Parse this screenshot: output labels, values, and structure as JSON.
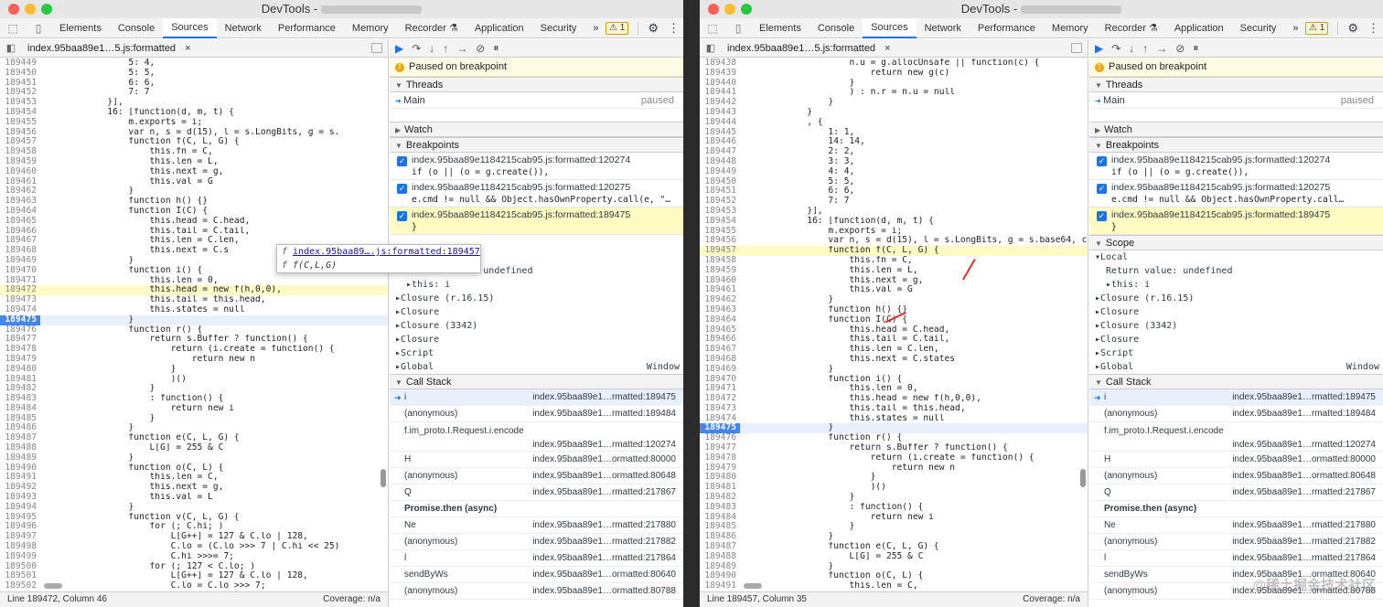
{
  "title": "DevTools -",
  "tabs": [
    "Elements",
    "Console",
    "Sources",
    "Network",
    "Performance",
    "Memory",
    "Recorder ⚗",
    "Application",
    "Security"
  ],
  "more_tabs": "»",
  "badge": "1",
  "left": {
    "file": "index.95baa89e1…5.js:formatted",
    "status_left": "Line 189472, Column 46",
    "status_right": "Coverage: n/a",
    "code": [
      [
        "189449",
        "                5: 4,",
        ""
      ],
      [
        "189450",
        "                5: 5,",
        ""
      ],
      [
        "189451",
        "                6: 6,",
        ""
      ],
      [
        "189452",
        "                7: 7",
        ""
      ],
      [
        "189453",
        "            }],",
        ""
      ],
      [
        "189454",
        "            16: [function(d, m, t) {",
        ""
      ],
      [
        "189455",
        "                m.exports = i;",
        ""
      ],
      [
        "189456",
        "                var n, s = d(15), l = s.LongBits, g = s.",
        ""
      ],
      [
        "189457",
        "                function f(C, L, G) {",
        ""
      ],
      [
        "189458",
        "                    this.fn = C,",
        ""
      ],
      [
        "189459",
        "                    this.len = L,",
        ""
      ],
      [
        "189460",
        "                    this.next = g,",
        ""
      ],
      [
        "189461",
        "                    this.val = G",
        ""
      ],
      [
        "189462",
        "                }",
        ""
      ],
      [
        "189463",
        "                function h() {}",
        ""
      ],
      [
        "189464",
        "                function I(C) {",
        ""
      ],
      [
        "189465",
        "                    this.head = C.head,",
        ""
      ],
      [
        "189466",
        "                    this.tail = C.tail,",
        ""
      ],
      [
        "189467",
        "                    this.len = C.len,",
        ""
      ],
      [
        "189468",
        "                    this.next = C.s",
        ""
      ],
      [
        "189469",
        "                }",
        ""
      ],
      [
        "189470",
        "                function i() {",
        ""
      ],
      [
        "189471",
        "                    this.len = 0,",
        ""
      ],
      [
        "189472",
        "                    this.head = new f(h,0,0),",
        "pause"
      ],
      [
        "189473",
        "                    this.tail = this.head,",
        ""
      ],
      [
        "189474",
        "                    this.states = null",
        ""
      ],
      [
        "189475",
        "                }",
        "bp"
      ],
      [
        "189476",
        "                function r() {",
        ""
      ],
      [
        "189477",
        "                    return s.Buffer ? function() {",
        ""
      ],
      [
        "189478",
        "                        return (i.create = function() {",
        ""
      ],
      [
        "189479",
        "                            return new n",
        ""
      ],
      [
        "189480",
        "                        }",
        ""
      ],
      [
        "189481",
        "                        )()",
        ""
      ],
      [
        "189482",
        "                    }",
        ""
      ],
      [
        "189483",
        "                    : function() {",
        ""
      ],
      [
        "189484",
        "                        return new i",
        ""
      ],
      [
        "189485",
        "                    }",
        ""
      ],
      [
        "189486",
        "                }",
        ""
      ],
      [
        "189487",
        "                function e(C, L, G) {",
        ""
      ],
      [
        "189488",
        "                    L[G] = 255 & C",
        ""
      ],
      [
        "189489",
        "                }",
        ""
      ],
      [
        "189490",
        "                function o(C, L) {",
        ""
      ],
      [
        "189491",
        "                    this.len = C,",
        ""
      ],
      [
        "189492",
        "                    this.next = g,",
        ""
      ],
      [
        "189493",
        "                    this.val = L",
        ""
      ],
      [
        "189494",
        "                }",
        ""
      ],
      [
        "189495",
        "                function v(C, L, G) {",
        ""
      ],
      [
        "189496",
        "                    for (; C.hi; )",
        ""
      ],
      [
        "189497",
        "                        L[G++] = 127 & C.lo | 128,",
        ""
      ],
      [
        "189498",
        "                        C.lo = (C.lo >>> 7 | C.hi << 25)",
        ""
      ],
      [
        "189499",
        "                        C.hi >>>= 7;",
        ""
      ],
      [
        "189500",
        "                    for (; 127 < C.lo; )",
        ""
      ],
      [
        "189501",
        "                        L[G++] = 127 & C.lo | 128,",
        ""
      ],
      [
        "189502",
        "                        C.lo = C.lo >>> 7;",
        ""
      ]
    ],
    "tooltip": {
      "link": "index.95baa89….js:formatted:189457",
      "sig": "f(C,L,G)",
      "f": "f"
    }
  },
  "right": {
    "file": "index.95baa89e1…5.js:formatted",
    "status_left": "Line 189457, Column 35",
    "status_right": "Coverage: n/a",
    "code": [
      [
        "189438",
        "                    n.u = g.allocUnsafe || function(c) {",
        ""
      ],
      [
        "189439",
        "                        return new g(c)",
        ""
      ],
      [
        "189440",
        "                    }",
        ""
      ],
      [
        "189441",
        "                    ) : n.r = n.u = null",
        ""
      ],
      [
        "189442",
        "                }",
        ""
      ],
      [
        "189443",
        "            }",
        ""
      ],
      [
        "189444",
        "            , {",
        ""
      ],
      [
        "189445",
        "                1: 1,",
        ""
      ],
      [
        "189446",
        "                14: 14,",
        ""
      ],
      [
        "189447",
        "                2: 2,",
        ""
      ],
      [
        "189448",
        "                3: 3,",
        ""
      ],
      [
        "189449",
        "                4: 4,",
        ""
      ],
      [
        "189450",
        "                5: 5,",
        ""
      ],
      [
        "189451",
        "                6: 6,",
        ""
      ],
      [
        "189452",
        "                7: 7",
        ""
      ],
      [
        "189453",
        "            }],",
        ""
      ],
      [
        "189454",
        "            16: [function(d, m, t) {",
        ""
      ],
      [
        "189455",
        "                m.exports = i;",
        ""
      ],
      [
        "189456",
        "                var n, s = d(15), l = s.LongBits, g = s.base64, c = s.utf8;",
        ""
      ],
      [
        "189457",
        "                function f(C, L, G) {",
        "pause"
      ],
      [
        "189458",
        "                    this.fn = C,",
        ""
      ],
      [
        "189459",
        "                    this.len = L,",
        ""
      ],
      [
        "189460",
        "                    this.next = g,",
        ""
      ],
      [
        "189461",
        "                    this.val = G",
        ""
      ],
      [
        "189462",
        "                }",
        ""
      ],
      [
        "189463",
        "                function h() {}",
        ""
      ],
      [
        "189464",
        "                function I(C) {",
        ""
      ],
      [
        "189465",
        "                    this.head = C.head,",
        ""
      ],
      [
        "189466",
        "                    this.tail = C.tail,",
        ""
      ],
      [
        "189467",
        "                    this.len = C.len,",
        ""
      ],
      [
        "189468",
        "                    this.next = C.states",
        ""
      ],
      [
        "189469",
        "                }",
        ""
      ],
      [
        "189470",
        "                function i() {",
        ""
      ],
      [
        "189471",
        "                    this.len = 0,",
        ""
      ],
      [
        "189472",
        "                    this.head = new f(h,0,0),",
        ""
      ],
      [
        "189473",
        "                    this.tail = this.head,",
        ""
      ],
      [
        "189474",
        "                    this.states = null",
        ""
      ],
      [
        "189475",
        "                }",
        "bp"
      ],
      [
        "189476",
        "                function r() {",
        ""
      ],
      [
        "189477",
        "                    return s.Buffer ? function() {",
        ""
      ],
      [
        "189478",
        "                        return (i.create = function() {",
        ""
      ],
      [
        "189479",
        "                            return new n",
        ""
      ],
      [
        "189480",
        "                        }",
        ""
      ],
      [
        "189481",
        "                        )()",
        ""
      ],
      [
        "189482",
        "                    }",
        ""
      ],
      [
        "189483",
        "                    : function() {",
        ""
      ],
      [
        "189484",
        "                        return new i",
        ""
      ],
      [
        "189485",
        "                    }",
        ""
      ],
      [
        "189486",
        "                }",
        ""
      ],
      [
        "189487",
        "                function e(C, L, G) {",
        ""
      ],
      [
        "189488",
        "                    L[G] = 255 & C",
        ""
      ],
      [
        "189489",
        "                }",
        ""
      ],
      [
        "189490",
        "                function o(C, L) {",
        ""
      ],
      [
        "189491",
        "                    this.len = C,",
        ""
      ]
    ]
  },
  "debugger": {
    "paused": "Paused on breakpoint",
    "threads_title": "Threads",
    "thread_main": "Main",
    "thread_status": "paused",
    "watch_title": "Watch",
    "breakpoints_title": "Breakpoints",
    "breakpoints": [
      {
        "file": "index.95baa89e1184215cab95.js:formatted:120274",
        "code": "if (o || (o = g.create()),"
      },
      {
        "file": "index.95baa89e1184215cab95.js:formatted:120275",
        "code": "e.cmd != null && Object.hasOwnProperty.call(e, \"…"
      },
      {
        "file": "index.95baa89e1184215cab95.js:formatted:189475",
        "code": "}"
      }
    ],
    "breakpoints_right": [
      {
        "file": "index.95baa89e1184215cab95.js:formatted:120274",
        "code": "if (o || (o = g.create()),"
      },
      {
        "file": "index.95baa89e1184215cab95.js:formatted:120275",
        "code": "e.cmd != null && Object.hasOwnProperty.call…"
      },
      {
        "file": "index.95baa89e1184215cab95.js:formatted:189475",
        "code": "}"
      }
    ],
    "scope_title": "Scope",
    "scope": [
      [
        "▾Local",
        "",
        ""
      ],
      [
        "Return value: undefined",
        "",
        "ind"
      ],
      [
        "▸this: i",
        "",
        "ind"
      ],
      [
        "▸Closure (r.16.15)",
        "",
        ""
      ],
      [
        "▸Closure",
        "",
        ""
      ],
      [
        "▸Closure (3342)",
        "",
        ""
      ],
      [
        "▸Closure",
        "",
        ""
      ],
      [
        "▸Script",
        "",
        ""
      ],
      [
        "▸Global",
        "Window",
        ""
      ]
    ],
    "callstack_title": "Call Stack",
    "callstack": [
      {
        "fn": "i",
        "loc": "index.95baa89e1…rmatted:189475",
        "cur": true
      },
      {
        "fn": "(anonymous)",
        "loc": "index.95baa89e1…rmatted:189484"
      },
      {
        "fn": "f.im_proto.I.Request.i.encode",
        "loc": "index.95baa89e1…rmatted:120274",
        "two": true
      },
      {
        "fn": "H",
        "loc": "index.95baa89e1…ormatted:80000"
      },
      {
        "fn": "(anonymous)",
        "loc": "index.95baa89e1…ormatted:80648"
      },
      {
        "fn": "Q",
        "loc": "index.95baa89e1…rmatted:217867"
      },
      {
        "async": "Promise.then (async)"
      },
      {
        "fn": "Ne",
        "loc": "index.95baa89e1…rmatted:217880"
      },
      {
        "fn": "(anonymous)",
        "loc": "index.95baa89e1…rmatted:217882"
      },
      {
        "fn": "l",
        "loc": "index.95baa89e1…rmatted:217864"
      },
      {
        "fn": "sendByWs",
        "loc": "index.95baa89e1…ormatted:80640"
      },
      {
        "fn": "(anonymous)",
        "loc": "index.95baa89e1…ormatted:80788"
      }
    ]
  },
  "watermark": "@稀土掘金技术社区"
}
